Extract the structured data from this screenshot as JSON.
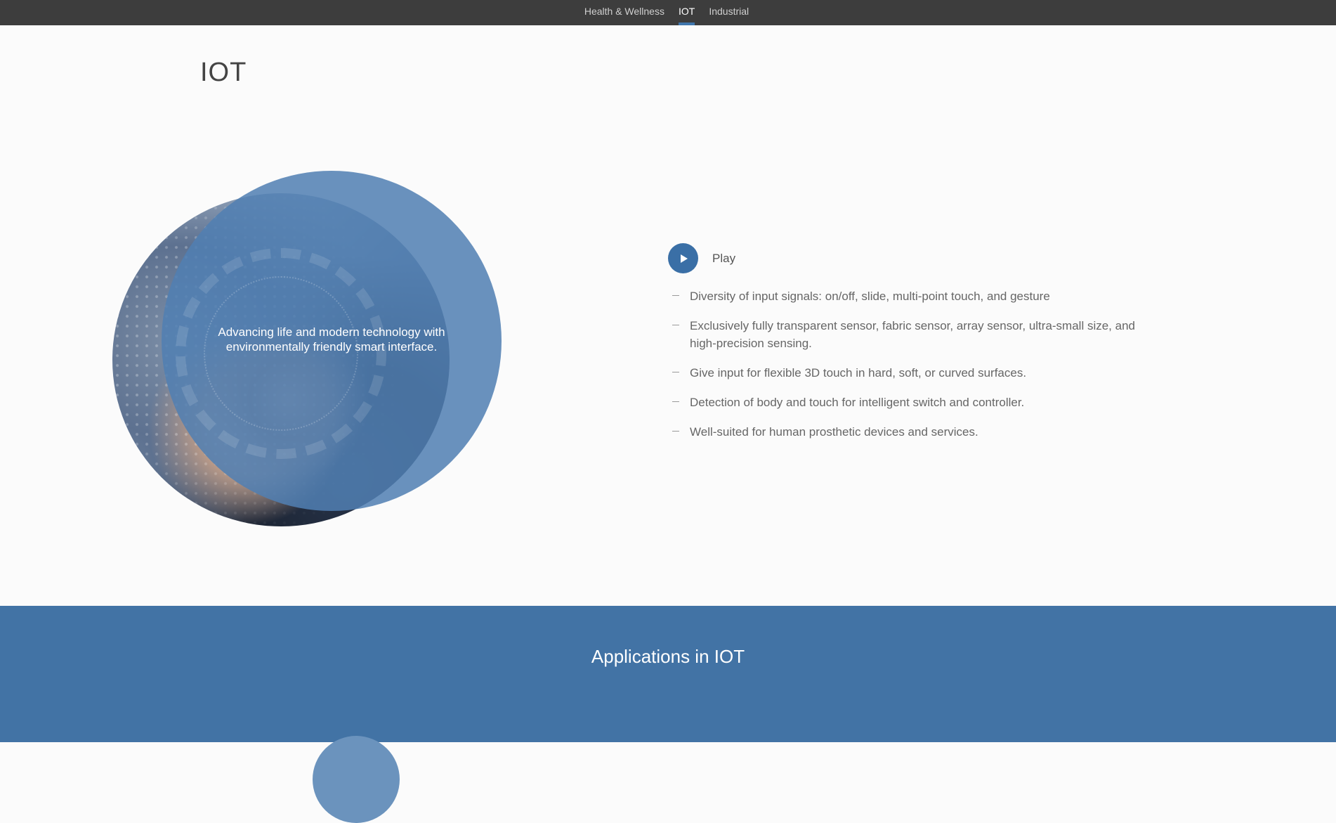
{
  "nav": {
    "tabs": [
      {
        "label": "Health & Wellness",
        "active": false
      },
      {
        "label": "IOT",
        "active": true
      },
      {
        "label": "Industrial",
        "active": false
      }
    ]
  },
  "page": {
    "title": "IOT"
  },
  "hero": {
    "tagline": "Advancing life and modern technology with environmentally friendly smart interface."
  },
  "features": {
    "play_label": "Play",
    "items": [
      "Diversity of input signals: on/off, slide, multi-point touch, and gesture",
      "Exclusively fully transparent sensor, fabric sensor, array sensor, ultra-small size, and high-precision sensing.",
      "Give input for flexible 3D touch in hard, soft, or curved surfaces.",
      "Detection of body and touch for intelligent switch and controller.",
      "Well-suited for human prosthetic devices and services."
    ]
  },
  "applications": {
    "title": "Applications in IOT"
  },
  "colors": {
    "nav_bg": "#3d3d3d",
    "accent": "#3f76ad",
    "band_bg": "#4273a5"
  }
}
